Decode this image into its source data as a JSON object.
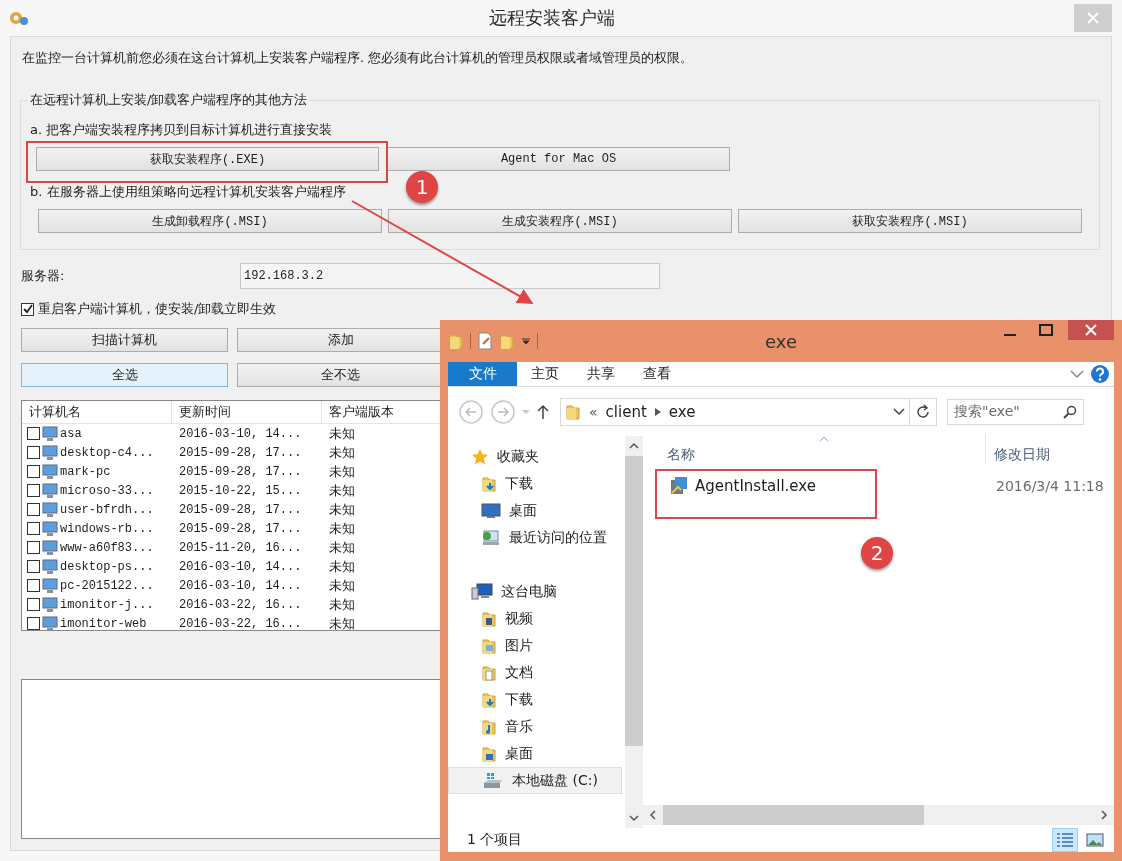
{
  "main_window": {
    "title": "远程安装客户端",
    "intro": "在监控一台计算机前您必须在这台计算机上安装客户端程序. 您必须有此台计算机的管理员权限或者域管理员的权限。",
    "group": {
      "title": "在远程计算机上安装/卸载客户端程序的其他方法",
      "sections": [
        {
          "label": "a. 把客户端安装程序拷贝到目标计算机进行直接安装",
          "buttons": [
            "获取安装程序(.EXE)",
            "Agent for Mac OS"
          ]
        },
        {
          "label": "b. 在服务器上使用组策略向远程计算机安装客户端程序",
          "buttons": [
            "生成卸载程序(.MSI)",
            "生成安装程序(.MSI)",
            "获取安装程序(.MSI)"
          ]
        }
      ]
    },
    "server": {
      "label": "服务器:",
      "value": "192.168.3.2"
    },
    "restart_option": {
      "label": "重启客户端计算机，使安装/卸载立即生效",
      "checked": true
    },
    "action_buttons": [
      {
        "label": "扫描计算机",
        "focused": false
      },
      {
        "label": "添加",
        "focused": false
      },
      {
        "label": "全选",
        "focused": true
      },
      {
        "label": "全不选",
        "focused": false
      }
    ],
    "table": {
      "columns": [
        "计算机名",
        "更新时间",
        "客户端版本"
      ],
      "rows": [
        {
          "checked": false,
          "cells": [
            "asa",
            "2016-03-10, 14...",
            "未知"
          ]
        },
        {
          "checked": false,
          "cells": [
            "desktop-c4...",
            "2015-09-28, 17...",
            "未知"
          ]
        },
        {
          "checked": false,
          "cells": [
            "mark-pc",
            "2015-09-28, 17...",
            "未知"
          ]
        },
        {
          "checked": false,
          "cells": [
            "microso-33...",
            "2015-10-22, 15...",
            "未知"
          ]
        },
        {
          "checked": false,
          "cells": [
            "user-bfrdh...",
            "2015-09-28, 17...",
            "未知"
          ]
        },
        {
          "checked": false,
          "cells": [
            "windows-rb...",
            "2015-09-28, 17...",
            "未知"
          ]
        },
        {
          "checked": false,
          "cells": [
            "www-a60f83...",
            "2015-11-20, 16...",
            "未知"
          ]
        },
        {
          "checked": false,
          "cells": [
            "desktop-ps...",
            "2016-03-10, 14...",
            "未知"
          ]
        },
        {
          "checked": false,
          "cells": [
            "pc-2015122...",
            "2016-03-10, 14...",
            "未知"
          ]
        },
        {
          "checked": false,
          "cells": [
            "imonitor-j...",
            "2016-03-22, 16...",
            "未知"
          ]
        },
        {
          "checked": false,
          "cells": [
            "imonitor-web",
            "2016-03-22, 16...",
            "未知"
          ]
        }
      ]
    }
  },
  "explorer": {
    "title": "exe",
    "ribbon_tabs": [
      {
        "label": "文件",
        "selected": true
      },
      {
        "label": "主页",
        "selected": false
      },
      {
        "label": "共享",
        "selected": false
      },
      {
        "label": "查看",
        "selected": false
      }
    ],
    "path": {
      "overflow": "«",
      "segments": [
        "client",
        "exe"
      ]
    },
    "search": {
      "placeholder": "搜索\"exe\""
    },
    "nav": [
      {
        "label": "收藏夹",
        "kind": "favorites",
        "selected": false,
        "children": [
          {
            "label": "下载",
            "kind": "downloads",
            "selected": false
          },
          {
            "label": "桌面",
            "kind": "desktop",
            "selected": false
          },
          {
            "label": "最近访问的位置",
            "kind": "recent",
            "selected": false
          }
        ]
      },
      {
        "label": "这台电脑",
        "kind": "pc",
        "selected": false,
        "children": [
          {
            "label": "视频",
            "kind": "videos",
            "selected": false
          },
          {
            "label": "图片",
            "kind": "pictures",
            "selected": false
          },
          {
            "label": "文档",
            "kind": "documents",
            "selected": false
          },
          {
            "label": "下载",
            "kind": "downloads",
            "selected": false
          },
          {
            "label": "音乐",
            "kind": "music",
            "selected": false
          },
          {
            "label": "桌面",
            "kind": "desktop-folder",
            "selected": false
          },
          {
            "label": "本地磁盘 (C:)",
            "kind": "drive",
            "selected": true
          }
        ]
      }
    ],
    "columns": [
      "名称",
      "修改日期"
    ],
    "files": [
      {
        "name": "AgentInstall.exe",
        "modified": "2016/3/4 11:18"
      }
    ],
    "status": "1 个项目",
    "view_modes": [
      {
        "kind": "details",
        "selected": true
      },
      {
        "kind": "thumbnails",
        "selected": false
      }
    ]
  },
  "annotations": [
    {
      "label": "1"
    },
    {
      "label": "2"
    }
  ]
}
